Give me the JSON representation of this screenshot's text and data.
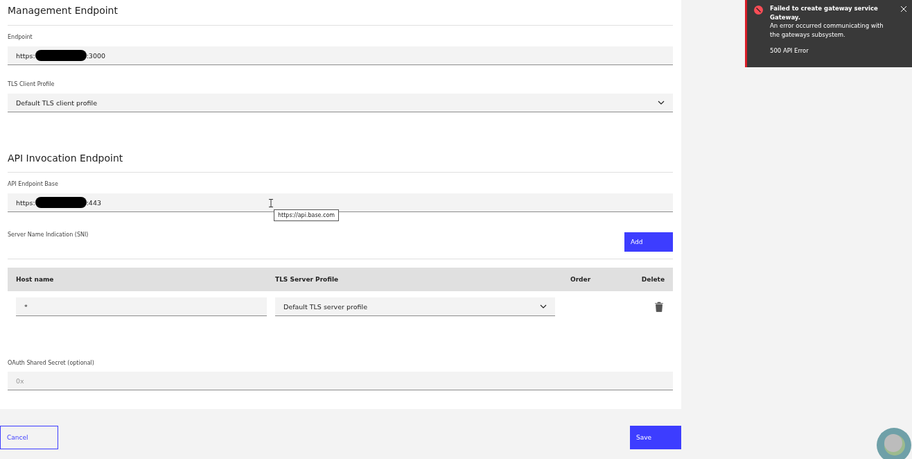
{
  "management": {
    "title": "Management Endpoint",
    "endpoint": {
      "label": "Endpoint",
      "value_start": "https:",
      "value_end": ":3000",
      "redacted": true
    },
    "tls_client_profile": {
      "label": "TLS Client Profile",
      "value": "Default TLS client profile"
    }
  },
  "api_invocation": {
    "title": "API Invocation Endpoint",
    "endpoint_base": {
      "label": "API Endpoint Base",
      "value_start": "https:",
      "value_end": ":443",
      "redacted": true,
      "tooltip": "https://api.base.com"
    }
  },
  "sni": {
    "label": "Server Name Indication (SNI)",
    "add_button": "Add",
    "columns": [
      "Host name",
      "TLS Server Profile",
      "Order",
      "Delete"
    ],
    "rows": [
      {
        "host": "*",
        "profile": "Default TLS server profile"
      }
    ]
  },
  "oauth": {
    "label": "OAuth Shared Secret (optional)",
    "placeholder": "0x"
  },
  "buttons": {
    "cancel": "Cancel",
    "save": "Save"
  },
  "toast": {
    "title": "Failed to create gateway service Gateway.",
    "message": "An error occurred communicating with the gateways subsystem.",
    "detail": "500 API Error"
  }
}
